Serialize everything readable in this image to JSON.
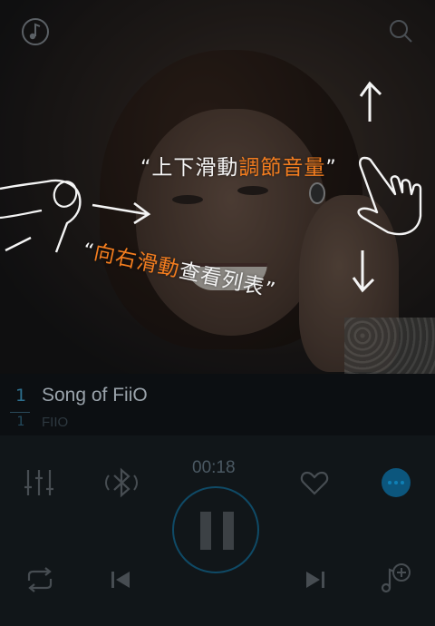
{
  "top_bar": {
    "left_icon": "music-note-icon",
    "right_icon": "search-icon"
  },
  "gesture_hints": {
    "vertical_quote_open": "“",
    "vertical_action": "上下滑動",
    "vertical_result": "調節音量",
    "vertical_quote_close": "”",
    "horizontal_quote_open": "“",
    "horizontal_action": "向右滑動",
    "horizontal_result": "查看列表",
    "horizontal_quote_close": "”"
  },
  "track": {
    "number": "1",
    "number_sub": "1",
    "title": "Song of FiiO",
    "artist": "FIIO"
  },
  "player": {
    "elapsed_time": "00:18",
    "state": "playing"
  },
  "controls": {
    "equalizer_icon": "equalizer-icon",
    "bluetooth_icon": "bluetooth-icon",
    "favorite_icon": "heart-icon",
    "more_icon": "more-icon",
    "pause_icon": "pause-icon",
    "repeat_icon": "repeat-icon",
    "previous_icon": "previous-icon",
    "next_icon": "next-icon",
    "add_to_playlist_icon": "add-music-icon"
  },
  "colors": {
    "accent": "#f37d1f",
    "highlight_blue": "#0f80b6"
  }
}
